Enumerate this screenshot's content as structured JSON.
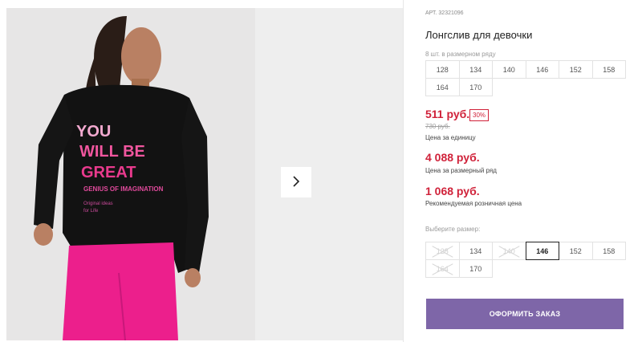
{
  "product": {
    "article_label": "АРТ. 32321096",
    "title": "Лонгслив для девочки",
    "row_note": "8 шт. в размерном ряду",
    "row_sizes": [
      "128",
      "134",
      "140",
      "146",
      "152",
      "158",
      "164",
      "170"
    ],
    "price_unit": "511 руб.",
    "discount": "30%",
    "old_price": "730 руб.",
    "price_unit_caption": "Цена за единицу",
    "price_row": "4 088 руб.",
    "price_row_caption": "Цена за размерный ряд",
    "price_retail": "1 068 руб.",
    "price_retail_caption": "Рекомендуемая розничная цена",
    "choose_label": "Выберите размер:",
    "pick_sizes": [
      {
        "label": "128",
        "state": "disabled"
      },
      {
        "label": "134",
        "state": "available"
      },
      {
        "label": "140",
        "state": "disabled"
      },
      {
        "label": "146",
        "state": "selected"
      },
      {
        "label": "152",
        "state": "available"
      },
      {
        "label": "158",
        "state": "available"
      },
      {
        "label": "164",
        "state": "disabled"
      },
      {
        "label": "170",
        "state": "available"
      }
    ],
    "order_button": "ОФОРМИТЬ ЗАКАЗ"
  },
  "photo": {
    "shirt_text_1": "YOU",
    "shirt_text_2": "WILL BE",
    "shirt_text_3": "GREAT",
    "shirt_text_4": "GENIUS OF IMAGINATION",
    "shirt_text_5": "Original ideas",
    "shirt_text_6": "for Life"
  },
  "gallery": {
    "next_icon": "chevron-right-icon"
  },
  "colors": {
    "price": "#d0223a",
    "button": "#7e66a8"
  }
}
